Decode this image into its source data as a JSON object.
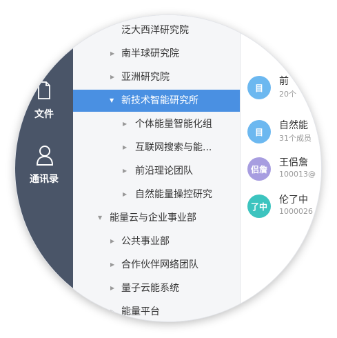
{
  "sidebar": {
    "items": [
      {
        "label": "文件",
        "icon": "document-icon"
      },
      {
        "label": "通讯录",
        "icon": "contacts-person-icon"
      }
    ]
  },
  "tree": {
    "items": [
      {
        "label": "泛大西洋研究院"
      },
      {
        "label": "南半球研究院"
      },
      {
        "label": "亚洲研究院"
      },
      {
        "label": "新技术智能研究所"
      },
      {
        "label": "个体能量智能化组"
      },
      {
        "label": "互联网搜索与能..."
      },
      {
        "label": "前沿理论团队"
      },
      {
        "label": "自然能量操控研究"
      },
      {
        "label": "能量云与企业事业部"
      },
      {
        "label": "公共事业部"
      },
      {
        "label": "合作伙伴网络团队"
      },
      {
        "label": "量子云能系统"
      },
      {
        "label": "能量平台"
      }
    ]
  },
  "contacts": {
    "items": [
      {
        "avatar": "目",
        "name": "",
        "sub": "",
        "color": "#6cb8f0"
      },
      {
        "avatar": "目",
        "name": "前",
        "sub": "20个",
        "color": "#6cb8f0"
      },
      {
        "avatar": "目",
        "name": "自然能",
        "sub": "31个成员",
        "color": "#6cb8f0"
      },
      {
        "avatar": "侣詹",
        "name": "王侣詹",
        "sub": "100013@",
        "color": "#a79de0"
      },
      {
        "avatar": "了中",
        "name": "伦了中",
        "sub": "1000026",
        "color": "#3cc4bf"
      }
    ]
  }
}
